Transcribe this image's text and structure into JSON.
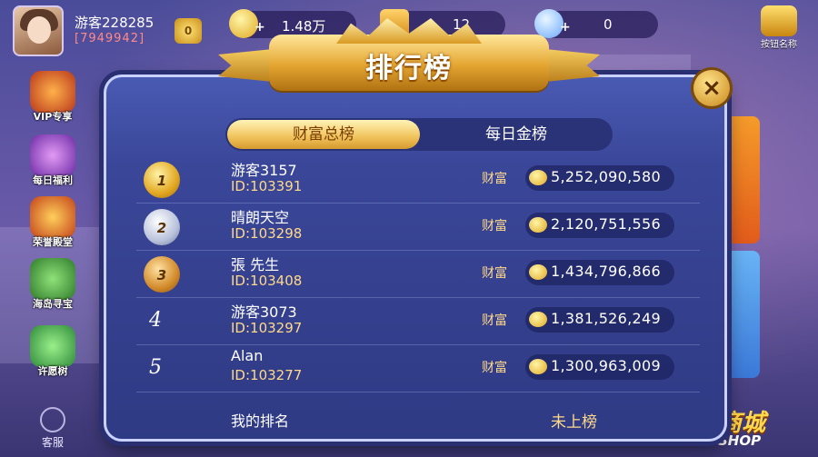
{
  "user": {
    "name": "游客228285",
    "id_display": "[7949942]",
    "vip_level": "0"
  },
  "currencies": [
    {
      "icon": "gold-ingot-icon",
      "value": "1.48万"
    },
    {
      "icon": "ticket-icon",
      "value": "12"
    },
    {
      "icon": "diamond-icon",
      "value": "0"
    }
  ],
  "sign_in": {
    "label": "按钮名称"
  },
  "sidebar": {
    "items": [
      {
        "label": "VIP专享",
        "icon": "vip-icon"
      },
      {
        "label": "每日福利",
        "icon": "gift-icon"
      },
      {
        "label": "荣誉殿堂",
        "icon": "honor-icon"
      },
      {
        "label": "海岛寻宝",
        "icon": "treasure-icon"
      },
      {
        "label": "许愿树",
        "icon": "wish-tree-icon"
      }
    ]
  },
  "kefu": {
    "label": "客服"
  },
  "shop": {
    "cn": "商城",
    "en": "SHOP"
  },
  "leaderboard": {
    "title": "排行榜",
    "close": "×",
    "tabs": [
      {
        "label": "财富总榜",
        "active": true
      },
      {
        "label": "每日金榜",
        "active": false
      }
    ],
    "wealth_label": "财富",
    "rows": [
      {
        "rank": "1",
        "name": "游客3157",
        "id": "ID:103391",
        "wealth": "5,252,090,580",
        "medal": "gold"
      },
      {
        "rank": "2",
        "name": "晴朗天空",
        "id": "ID:103298",
        "wealth": "2,120,751,556",
        "medal": "silver"
      },
      {
        "rank": "3",
        "name": "張 先生",
        "id": "ID:103408",
        "wealth": "1,434,796,866",
        "medal": "bronze"
      },
      {
        "rank": "4",
        "name": "游客3073",
        "id": "ID:103297",
        "wealth": "1,381,526,249",
        "medal": ""
      },
      {
        "rank": "5",
        "name": "Alan",
        "id": "ID:103277",
        "wealth": "1,300,963,009",
        "medal": ""
      }
    ],
    "my_rank_label": "我的排名",
    "my_rank_value": "未上榜"
  },
  "colors": {
    "gold_text": "#ffd98a",
    "accent": "#f0c25a",
    "modal_bg": "#2f3a84"
  }
}
